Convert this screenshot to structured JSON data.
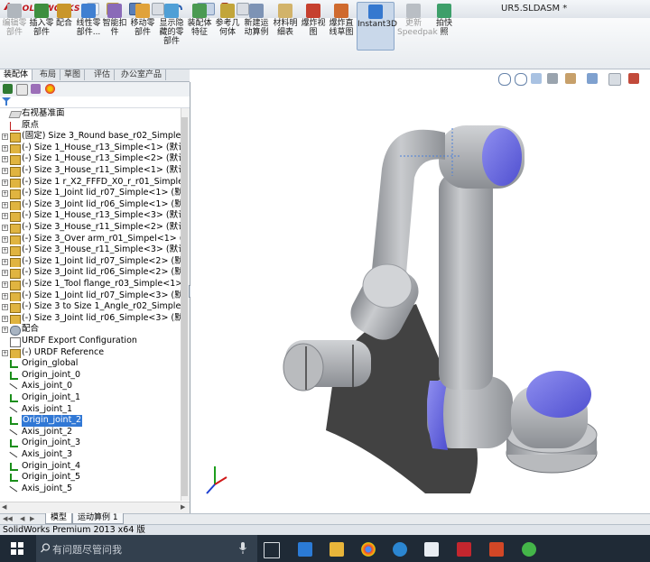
{
  "app": {
    "logo": "SOLIDWORKS",
    "document_title": "UR5.SLDASM *"
  },
  "ribbon": {
    "buttons": [
      {
        "label": "编辑零部件",
        "state": "disabled"
      },
      {
        "label": "插入零部件",
        "state": "normal"
      },
      {
        "label": "配合",
        "state": "normal"
      },
      {
        "label": "线性零部件...",
        "state": "normal"
      },
      {
        "label": "智能扣件",
        "state": "normal"
      },
      {
        "label": "移动零部件",
        "state": "normal"
      },
      {
        "label": "显示隐藏的零部件",
        "state": "normal"
      },
      {
        "label": "装配体特征",
        "state": "normal"
      },
      {
        "label": "参考几何体",
        "state": "normal"
      },
      {
        "label": "新建运动算例",
        "state": "normal"
      },
      {
        "label": "材料明细表",
        "state": "normal"
      },
      {
        "label": "爆炸视图",
        "state": "normal"
      },
      {
        "label": "爆炸直线草图",
        "state": "normal"
      },
      {
        "label": "Instant3D",
        "state": "active"
      },
      {
        "label": "更新Speedpak",
        "state": "disabled"
      },
      {
        "label": "拍快照",
        "state": "normal"
      }
    ]
  },
  "command_tabs": [
    "装配体",
    "布局",
    "草图",
    "评估",
    "办公室产品"
  ],
  "tree": {
    "items": [
      {
        "label": "右视基准面",
        "icon": "plane-icon",
        "expand": ""
      },
      {
        "label": "原点",
        "icon": "origin-icon",
        "expand": ""
      },
      {
        "label": "(固定) Size 3_Round base_r02_Simple<1>",
        "icon": "part-icon",
        "expand": "+"
      },
      {
        "label": "(-) Size 1_House_r13_Simple<1> (默认<<默",
        "icon": "part-icon",
        "expand": "+"
      },
      {
        "label": "(-) Size 1_House_r13_Simple<2> (默认<<默",
        "icon": "part-icon",
        "expand": "+"
      },
      {
        "label": "(-) Size 3_House_r11_Simple<1> (默认<<默",
        "icon": "part-icon",
        "expand": "+"
      },
      {
        "label": "(-) Size 1 r_X2_FFFD_X0_r_r01_Simple<1>",
        "icon": "part-icon",
        "expand": "+"
      },
      {
        "label": "(-) Size 1_Joint lid_r07_Simple<1> (默认<<",
        "icon": "part-icon",
        "expand": "+"
      },
      {
        "label": "(-) Size 3_Joint lid_r06_Simple<1> (默认<<",
        "icon": "part-icon",
        "expand": "+"
      },
      {
        "label": "(-) Size 1_House_r13_Simple<3> (默认<<默",
        "icon": "part-icon",
        "expand": "+"
      },
      {
        "label": "(-) Size 3_House_r11_Simple<2> (默认<<默",
        "icon": "part-icon",
        "expand": "+"
      },
      {
        "label": "(-) Size 3_Over arm_r01_Simpel<1> (默认<<",
        "icon": "part-icon",
        "expand": "+"
      },
      {
        "label": "(-) Size 3_House_r11_Simple<3> (默认<<默",
        "icon": "part-icon",
        "expand": "+"
      },
      {
        "label": "(-) Size 1_Joint lid_r07_Simple<2> (默认<<",
        "icon": "part-icon",
        "expand": "+"
      },
      {
        "label": "(-) Size 3_Joint lid_r06_Simple<2> (默认<<",
        "icon": "part-icon",
        "expand": "+"
      },
      {
        "label": "(-) Size 1_Tool flange_r03_Simple<1> (默认",
        "icon": "part-icon",
        "expand": "+"
      },
      {
        "label": "(-) Size 1_Joint lid_r07_Simple<3> (默认<<",
        "icon": "part-icon",
        "expand": "+"
      },
      {
        "label": "(-) Size 3 to Size 1_Angle_r02_Simple<1>",
        "icon": "part-icon",
        "expand": "+"
      },
      {
        "label": "(-) Size 3_Joint lid_r06_Simple<3> (默认<<",
        "icon": "part-icon",
        "expand": "+"
      },
      {
        "label": "配合",
        "icon": "mates-icon",
        "expand": "+"
      },
      {
        "label": "URDF Export Configuration",
        "icon": "config-icon",
        "expand": ""
      },
      {
        "label": "(-) URDF Reference",
        "icon": "reference-icon",
        "expand": "+"
      },
      {
        "label": "Origin_global",
        "icon": "coord-icon",
        "expand": ""
      },
      {
        "label": "Origin_joint_0",
        "icon": "coord-icon",
        "expand": ""
      },
      {
        "label": "Axis_joint_0",
        "icon": "axis-icon",
        "expand": ""
      },
      {
        "label": "Origin_joint_1",
        "icon": "coord-icon",
        "expand": ""
      },
      {
        "label": "Axis_joint_1",
        "icon": "axis-icon",
        "expand": ""
      },
      {
        "label": "Origin_joint_2",
        "icon": "coord-icon",
        "expand": "",
        "selected": true
      },
      {
        "label": "Axis_joint_2",
        "icon": "axis-icon",
        "expand": ""
      },
      {
        "label": "Origin_joint_3",
        "icon": "coord-icon",
        "expand": ""
      },
      {
        "label": "Axis_joint_3",
        "icon": "axis-icon",
        "expand": ""
      },
      {
        "label": "Origin_joint_4",
        "icon": "coord-icon",
        "expand": ""
      },
      {
        "label": "Origin_joint_5",
        "icon": "coord-icon",
        "expand": ""
      },
      {
        "label": "Axis_joint_5",
        "icon": "axis-icon",
        "expand": ""
      }
    ]
  },
  "bottom_tabs": [
    "模型",
    "运动算例 1"
  ],
  "status": {
    "text": "SolidWorks Premium 2013 x64 版"
  },
  "taskbar": {
    "search_placeholder": "有问题尽管问我"
  },
  "colors": {
    "accent": "#3178d5",
    "arm_grey": "#a3a6ab",
    "joint_cap": "#6f6fe6"
  }
}
